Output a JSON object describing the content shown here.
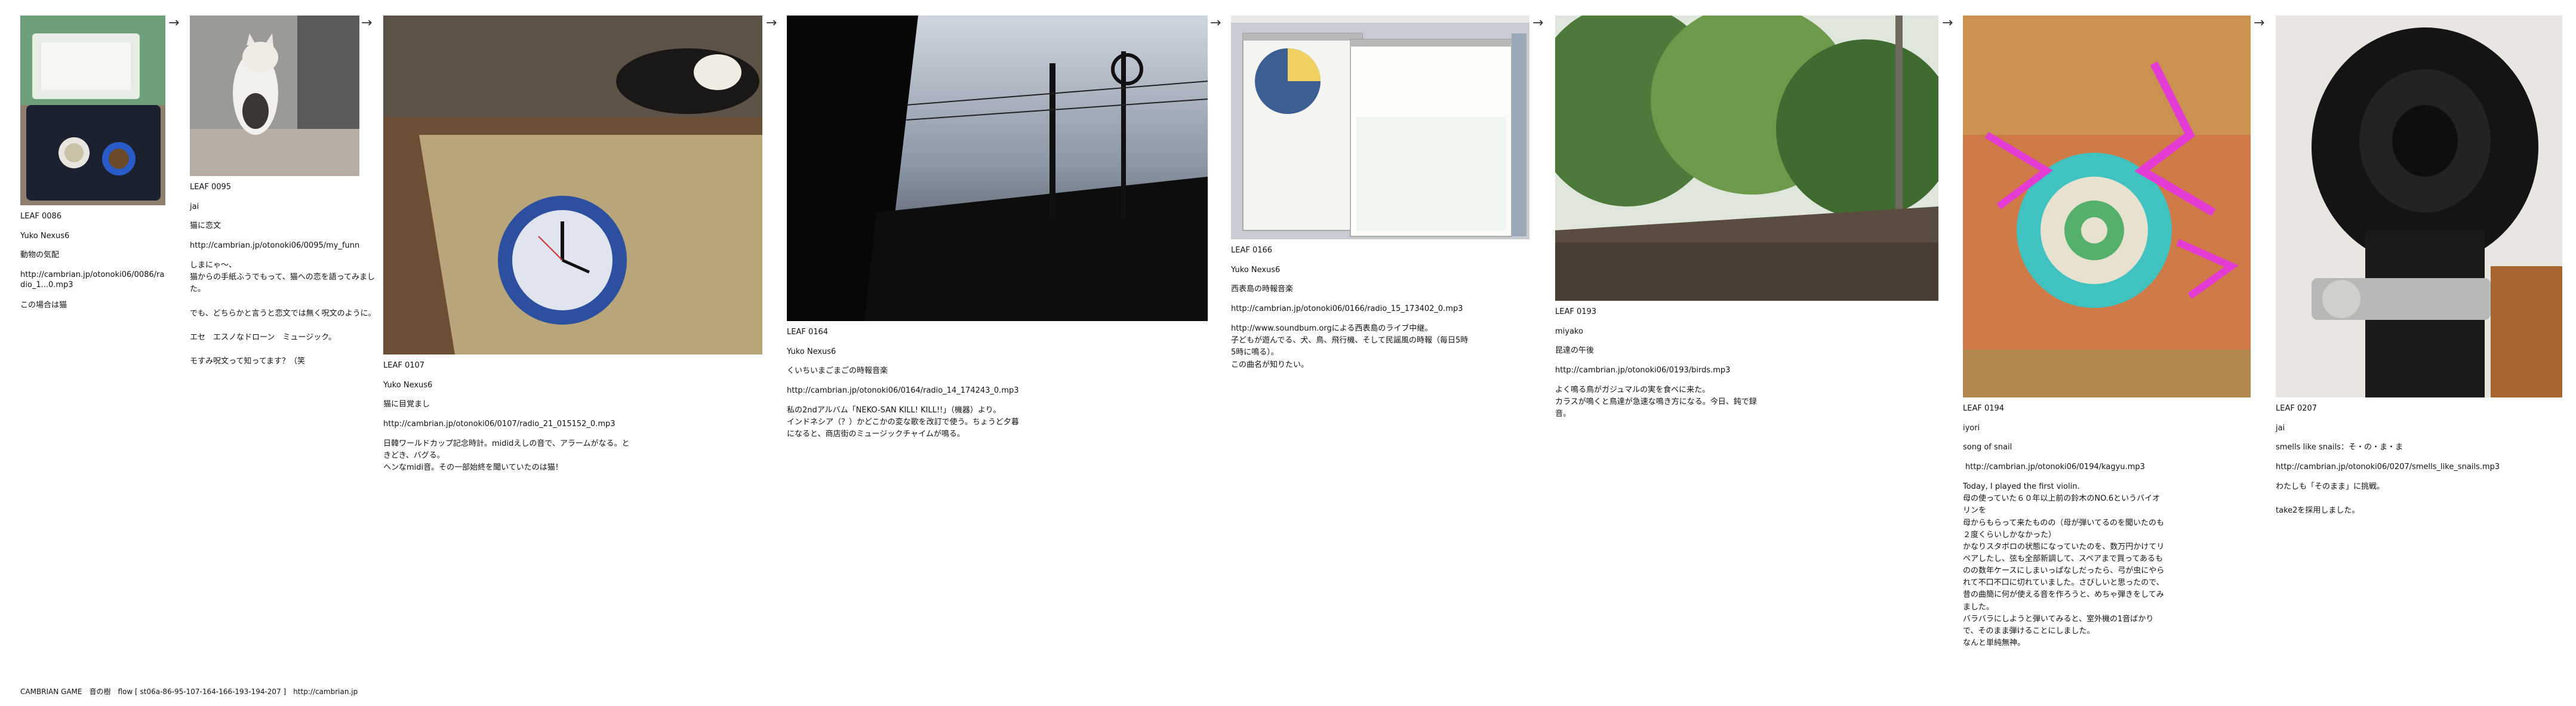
{
  "leaves": [
    {
      "leaf": "LEAF 0086",
      "author": "Yuko Nexus6",
      "title": "動物の気配",
      "url": "http://cambrian.jp/otonoki06/0086/radio_1...0.mp3",
      "body": "この場合は猫",
      "image": "cat-food-tray-photo"
    },
    {
      "leaf": "LEAF 0095",
      "author": "jai",
      "title": "猫に恋文",
      "url": "http://cambrian.jp/otonoki06/0095/my_funn",
      "body": "しまにゃ～、\n猫からの手紙ふうでもって、猫への恋を語ってみました。\n\nでも、どちらかと言うと恋文では無く呪文のように。\n\nエセ　エスノなドローン　ミュージック。\n\nモすみ呪文って知ってます？（笑",
      "image": "cat-standing-photo"
    },
    {
      "leaf": "LEAF 0107",
      "author": "Yuko Nexus6",
      "title": "猫に目覚まし",
      "url": "http://cambrian.jp/otonoki06/0107/radio_21_015152_0.mp3",
      "body": "日韓ワールドカップ記念時計。mididえしの音で、アラームがなる。ときどき、バグる。\nヘンなmidi音。その一部始終を聞いていたのは猫！",
      "image": "alarm-clock-on-tatami-photo"
    },
    {
      "leaf": "LEAF 0164",
      "author": "Yuko Nexus6",
      "title": "くいちいまごまごの時報音楽",
      "url": "http://cambrian.jp/otonoki06/0164/radio_14_174243_0.mp3",
      "body": "私の2ndアルバム「NEKO-SAN KILL! KILL!!」（機器）より。\nインドネシア（？）かどこかの変な歌を改訂で使う。ちょうど夕暮になると、商店街のミュージックチャイムが鳴る。",
      "image": "dusk-power-lines-photo"
    },
    {
      "leaf": "LEAF 0166",
      "author": "Yuko Nexus6",
      "title": "西表島の時報音楽",
      "url": "http://cambrian.jp/otonoki06/0166/radio_15_173402_0.mp3",
      "body": "http://www.soundbum.orgによる西表島のライブ中継。\n子どもが遊んでる、犬、鳥、飛行機、そして民謡風の時報（毎日5時5時に鳴る）。\nこの曲名が知りたい。",
      "image": "desktop-screenshot"
    },
    {
      "leaf": "LEAF 0193",
      "author": "miyako",
      "title": "昆達の午後",
      "url": "http://cambrian.jp/otonoki06/0193/birds.mp3",
      "body": "よく鳴る鳥がガジュマルの実を食べに来た。\nカラスが鳴くと鳥達が急速な鳴き方になる。今日、鈍で録音。",
      "image": "garden-trees-photo"
    },
    {
      "leaf": "LEAF 0194",
      "author": "iyori",
      "title": "song of snail",
      "url": "http://cambrian.jp/otonoki06/0194/kagyu.mp3",
      "body": "Today, I played the first violin.\n母の使っていた６０年以上前の鈴木のNO.6というバイオリンを\n母からもらって来たものの（母が弾いてるのを聞いたのも２度くらいしかなかった）\nかなりスタボロの状態になっていたのを、数万円かけてリペアしたし、弦も全部新調して、スペアまで買ってあるものの数年ケースにしまいっぱなしだったら、弓が虫にやられて不口不口に切れていました。さびしいと思ったので、昔の曲簡に何が使える音を作ろうと、めちゃ弾きをしてみました。\nバラバラにしようと弾いてみると、室外機の1音ばかりで、そのまま弾けることにしました。\nなんと単純無神。",
      "image": "snail-painting-photo"
    },
    {
      "leaf": "LEAF 0207",
      "author": "jai",
      "title": "smells like snails：そ・の・ま・ま",
      "url": "http://cambrian.jp/otonoki06/0207/smells_like_snails.mp3",
      "body": "わたしも「そのまま」に挑戦。\n\ntake2を採用しました。",
      "image": "cello-scroll-photo"
    }
  ],
  "arrows": [
    "→",
    "→",
    "→",
    "→",
    "→",
    "→",
    "→"
  ],
  "footer": "CAMBRIAN GAME　音の樹　flow [ st06a-86-95-107-164-166-193-194-207 ]　http://cambrian.jp"
}
